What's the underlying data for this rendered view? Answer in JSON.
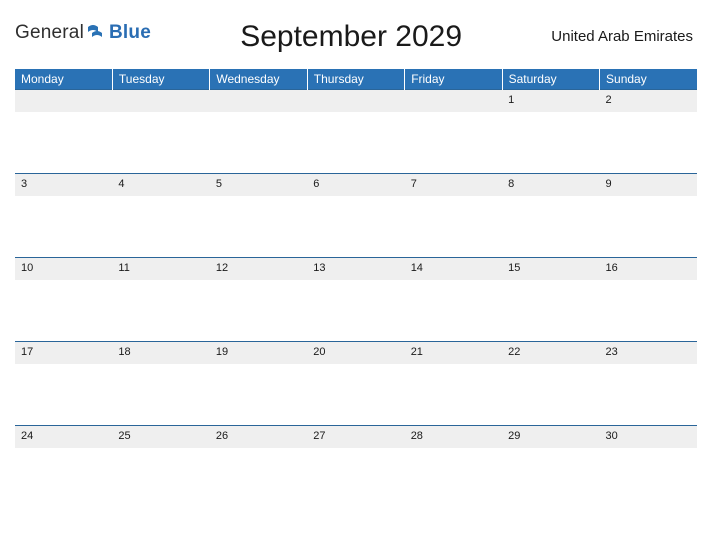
{
  "logo": {
    "general": "General",
    "blue": "Blue"
  },
  "title": "September 2029",
  "region": "United Arab Emirates",
  "day_headers": [
    "Monday",
    "Tuesday",
    "Wednesday",
    "Thursday",
    "Friday",
    "Saturday",
    "Sunday"
  ],
  "weeks": [
    [
      "",
      "",
      "",
      "",
      "",
      "1",
      "2"
    ],
    [
      "3",
      "4",
      "5",
      "6",
      "7",
      "8",
      "9"
    ],
    [
      "10",
      "11",
      "12",
      "13",
      "14",
      "15",
      "16"
    ],
    [
      "17",
      "18",
      "19",
      "20",
      "21",
      "22",
      "23"
    ],
    [
      "24",
      "25",
      "26",
      "27",
      "28",
      "29",
      "30"
    ]
  ],
  "colors": {
    "accent": "#2a72b5",
    "rule": "#2a6599"
  }
}
